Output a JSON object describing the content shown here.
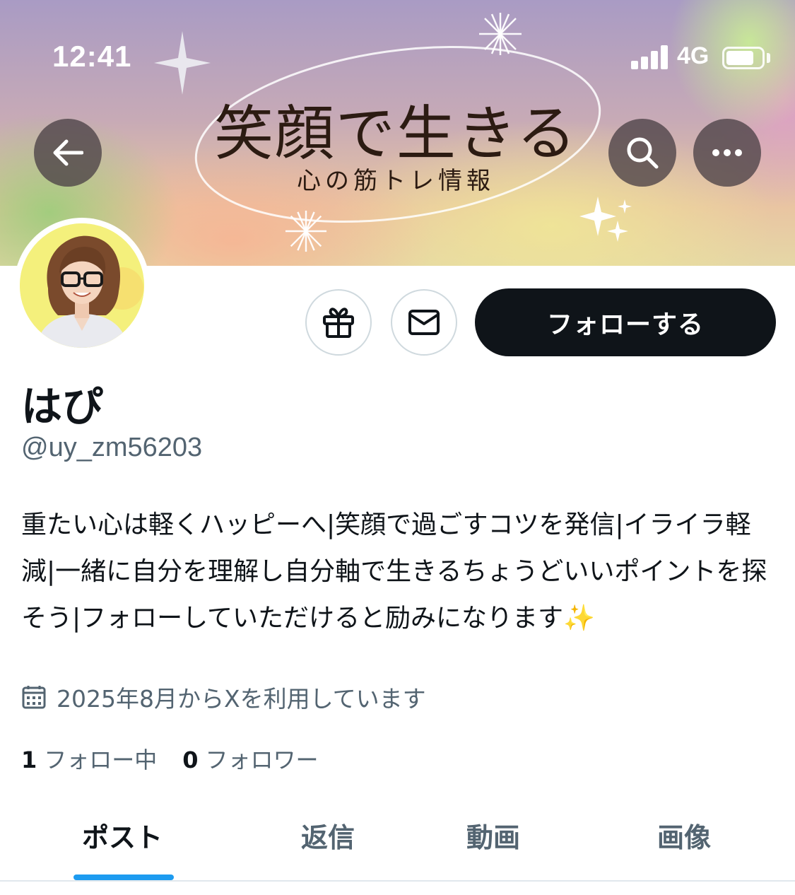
{
  "status_bar": {
    "time": "12:41",
    "network": "4G",
    "signal_icon": "signal-bars-icon",
    "battery_icon": "battery-icon"
  },
  "banner": {
    "title": "笑顔で生きる",
    "subtitle": "心の筋トレ情報"
  },
  "header_buttons": {
    "back_icon": "arrow-left-icon",
    "search_icon": "search-icon",
    "more_icon": "more-horizontal-icon"
  },
  "actions": {
    "gift_icon": "gift-icon",
    "message_icon": "envelope-icon",
    "follow_label": "フォローする"
  },
  "profile": {
    "display_name": "はぴ",
    "handle": "@uy_zm56203",
    "bio": "重たい心は軽くハッピーへ|笑顔で過ごすコツを発信|イライラ軽減|一緒に自分を理解し自分軸で生きるちょうどいいポイントを探そう|フォローしていただけると励みになります✨",
    "joined_icon": "calendar-icon",
    "joined": "2025年8月からXを利用しています"
  },
  "stats": {
    "following_count": "1",
    "following_label": "フォロー中",
    "followers_count": "0",
    "followers_label": "フォロワー"
  },
  "tabs": [
    {
      "label": "ポスト",
      "active": true
    },
    {
      "label": "返信",
      "active": false
    },
    {
      "label": "動画",
      "active": false
    },
    {
      "label": "画像",
      "active": false
    }
  ],
  "colors": {
    "accent": "#1d9bf0",
    "text_primary": "#0f1419",
    "text_secondary": "#536471",
    "follow_button": "#0f1419"
  }
}
